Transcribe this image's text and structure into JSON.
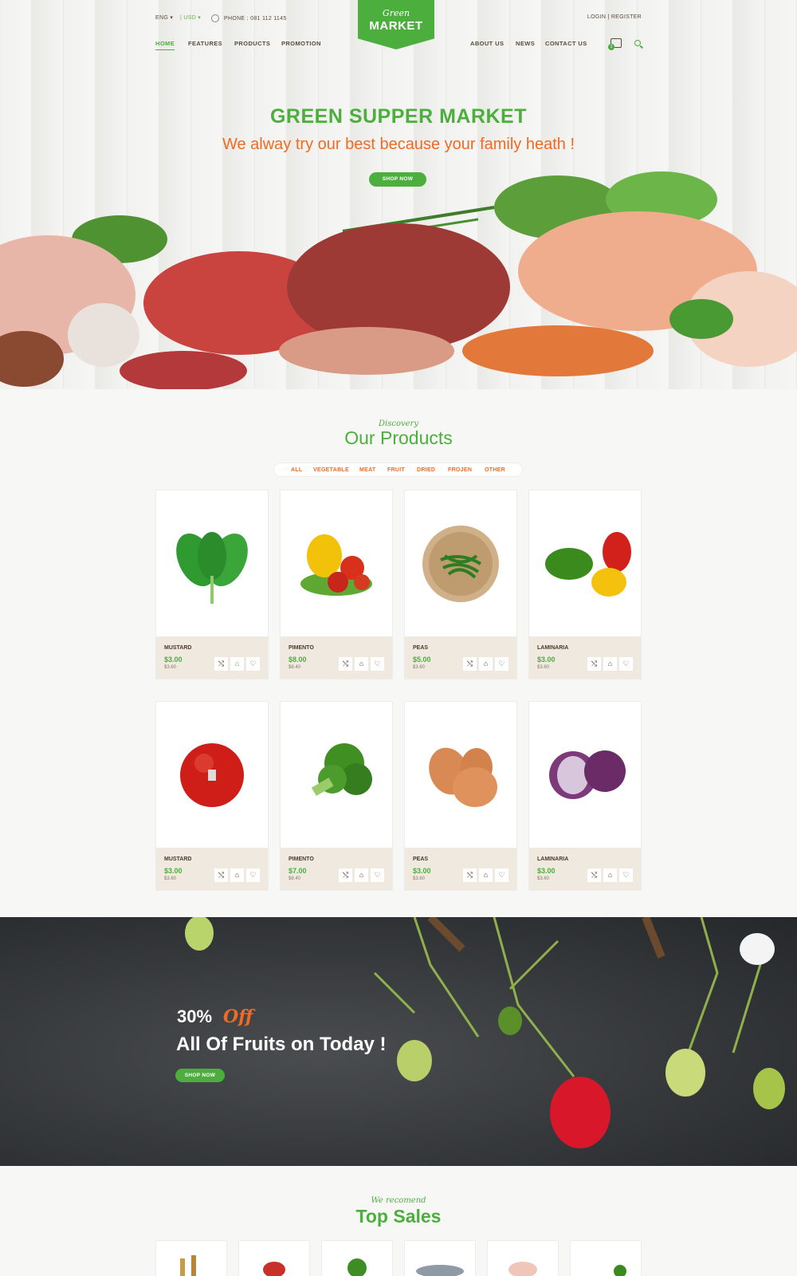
{
  "header": {
    "lang": "ENG",
    "currency": "USD",
    "phone": "PHONE : 081 112 1145",
    "login": "LOGIN",
    "auth_sep": "|",
    "register": "REGISTER",
    "cart_count": "1",
    "logo_script": "Green",
    "logo_main": "MARKET",
    "nav_left": [
      "HOME",
      "FEATURES",
      "PRODUCTS",
      "PROMOTION"
    ],
    "nav_right": [
      "ABOUT US",
      "NEWS",
      "CONTACT US"
    ]
  },
  "hero": {
    "title": "GREEN SUPPER MARKET",
    "subtitle": "We alway try our best because your family heath !",
    "button": "SHOP NOW"
  },
  "products": {
    "kicker": "Discovery",
    "title": "Our Products",
    "filters": [
      "ALL",
      "VEGETABLE",
      "MEAT",
      "FRUIT",
      "DRIED",
      "FROJEN",
      "OTHER"
    ],
    "items": [
      {
        "name": "MUSTARD",
        "price": "$3.00",
        "old": "$3.60",
        "image": "spinach"
      },
      {
        "name": "PIMENTO",
        "price": "$8.00",
        "old": "$8.40",
        "image": "pepper-tomato"
      },
      {
        "name": "PEAS",
        "price": "$5.00",
        "old": "$3.60",
        "image": "beans-basket"
      },
      {
        "name": "LAMINARIA",
        "price": "$3.00",
        "old": "$3.60",
        "image": "bell-peppers"
      },
      {
        "name": "MUSTARD",
        "price": "$3.00",
        "old": "$3.60",
        "image": "apple"
      },
      {
        "name": "PIMENTO",
        "price": "$7.00",
        "old": "$8.40",
        "image": "broccoli"
      },
      {
        "name": "PEAS",
        "price": "$3.00",
        "old": "$3.60",
        "image": "eggs"
      },
      {
        "name": "LAMINARIA",
        "price": "$3.00",
        "old": "$3.60",
        "image": "red-cabbage"
      }
    ]
  },
  "promo": {
    "percent": "30%",
    "off": "Off",
    "line": "All Of Fruits on Today !",
    "button": "SHOP NOW"
  },
  "top_sales": {
    "kicker": "We recomend",
    "title": "Top Sales"
  },
  "colors": {
    "brand_green": "#4caf3d",
    "accent_orange": "#f26a21",
    "brown": "#4a3a2a"
  }
}
